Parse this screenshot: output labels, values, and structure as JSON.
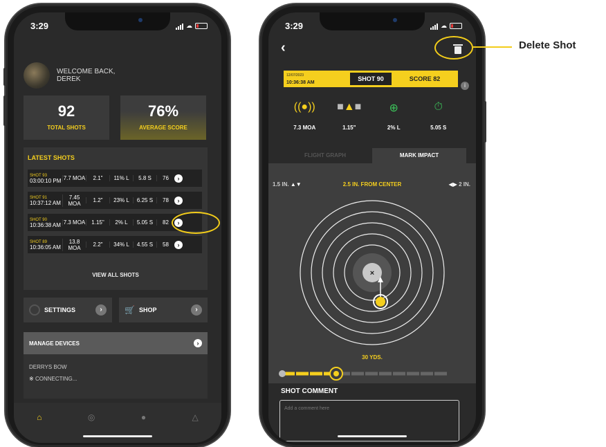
{
  "left_phone": {
    "status_time": "3:29",
    "welcome_line1": "WELCOME BACK,",
    "welcome_line2": "DEREK",
    "stats": [
      {
        "value": "92",
        "label": "TOTAL SHOTS"
      },
      {
        "value": "76%",
        "label": "AVERAGE SCORE"
      }
    ],
    "latest_title": "LATEST SHOTS",
    "shots": [
      {
        "num": "SHOT 93",
        "time": "03:00:10 PM",
        "c1": "7.7 MOA",
        "c2": "2.1\"",
        "c3": "11% L",
        "c4": "5.8 S",
        "score": "76"
      },
      {
        "num": "SHOT 91",
        "time": "10:37:12 AM",
        "c1": "7.45 MOA",
        "c2": "1.2\"",
        "c3": "23% L",
        "c4": "6.25 S",
        "score": "78"
      },
      {
        "num": "SHOT 90",
        "time": "10:36:38 AM",
        "c1": "7.3 MOA",
        "c2": "1.15\"",
        "c3": "2% L",
        "c4": "5.05 S",
        "score": "82"
      },
      {
        "num": "SHOT 89",
        "time": "10:36:05 AM",
        "c1": "13.8 MOA",
        "c2": "2.2\"",
        "c3": "34% L",
        "c4": "4.55 S",
        "score": "58"
      }
    ],
    "view_all": "VIEW ALL SHOTS",
    "settings_label": "SETTINGS",
    "shop_label": "SHOP",
    "manage_label": "MANAGE DEVICES",
    "device_name": "DERRYS BOW",
    "device_status": "CONNECTING..."
  },
  "right_phone": {
    "status_time": "3:29",
    "shot_date": "12/07/2023",
    "shot_time": "10:36:38 AM",
    "shot_label": "SHOT 90",
    "score_label": "SCORE 82",
    "metrics": [
      {
        "icon": "signal-icon",
        "value": "7.3 MOA"
      },
      {
        "icon": "level-icon",
        "value": "1.15\""
      },
      {
        "icon": "crosshair-icon",
        "value": "2% L"
      },
      {
        "icon": "stopwatch-icon",
        "value": "5.05 S"
      }
    ],
    "tab_left": "FLIGHT GRAPH",
    "tab_right": "MARK IMPACT",
    "left_adjust": "1.5 IN.",
    "center_text": "2.5 IN. FROM CENTER",
    "right_adjust": "2 IN.",
    "distance": "30 YDS.",
    "comment_title": "SHOT COMMENT",
    "comment_placeholder": "Add a comment here"
  },
  "callout": {
    "label": "Delete Shot",
    "color": "#f3cd1a"
  },
  "colors": {
    "accent": "#f5cf1e",
    "bg": "#2a2a2a"
  }
}
